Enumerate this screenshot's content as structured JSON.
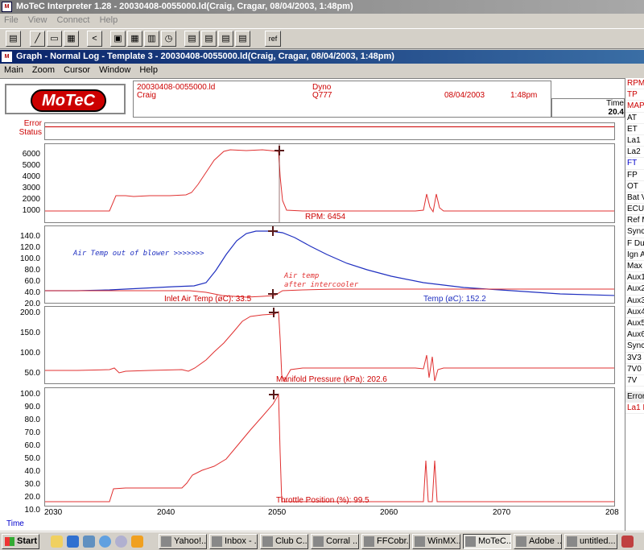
{
  "app_window": {
    "title": "MoTeC Interpreter 1.28 - 20030408-0055000.ld(Craig, Cragar, 08/04/2003,  1:48pm)",
    "menu": [
      "File",
      "View",
      "Connect",
      "Help"
    ]
  },
  "toolbar": {
    "buttons": [
      "open-icon",
      "graph-icon",
      "gauge-icon",
      "calc-icon",
      "back-icon",
      "report1-icon",
      "report2-icon",
      "report3-icon",
      "clock-icon",
      "export1-icon",
      "export2-icon",
      "export3-icon",
      "export4-icon"
    ],
    "ref_label": "ref"
  },
  "graph_window": {
    "title": "Graph - Normal Log - Template 3 - 20030408-0055000.ld(Craig, Cragar, 08/04/2003,  1:48pm)",
    "menu": [
      "Main",
      "Zoom",
      "Cursor",
      "Window",
      "Help"
    ]
  },
  "header": {
    "logo": "MoTeC",
    "file": "20030408-0055000.ld",
    "driver": "Craig",
    "session": "Dyno",
    "vehicle": "Q777",
    "date": "08/04/2003",
    "time": "1:48pm",
    "time_label": "Time",
    "time_value": "20.4"
  },
  "status_labels": {
    "error": "Error",
    "status": "Status"
  },
  "panels": [
    {
      "yticks": [
        "6000",
        "5000",
        "4000",
        "3000",
        "2000",
        "1000"
      ],
      "label": "RPM: 6454"
    },
    {
      "yticks": [
        "140.0",
        "120.0",
        "100.0",
        "80.0",
        "60.0",
        "40.0",
        "20.0"
      ],
      "label_inlet": "Inlet Air Temp (øC): 33.5",
      "label_temp": "Temp (øC): 152.2",
      "annot1": "Air Temp out of blower >>>>>>>",
      "annot2a": "Air temp",
      "annot2b": "after intercooler"
    },
    {
      "yticks": [
        "200.0",
        "150.0",
        "100.0",
        "50.0"
      ],
      "label": "Manifold Pressure (kPa): 202.6"
    },
    {
      "yticks": [
        "100.0",
        "90.0",
        "80.0",
        "70.0",
        "60.0",
        "50.0",
        "40.0",
        "30.0",
        "20.0",
        "10.0"
      ],
      "label": "Throttle Position (%): 99.5"
    }
  ],
  "x_axis": {
    "ticks": [
      "2030",
      "2040",
      "2050",
      "2060",
      "2070",
      "208"
    ],
    "label": "Time"
  },
  "channels": [
    "RPM",
    "TP",
    "MAP",
    "AT",
    "ET",
    "La1",
    "La2",
    "FT",
    "FP",
    "OT",
    "Bat V",
    "ECU",
    "Ref M",
    "Sync",
    "F Du",
    "Ign A",
    "Max",
    "Aux1",
    "Aux2",
    "Aux3",
    "Aux4",
    "Aux5",
    "Aux6",
    "Sync",
    "3V3",
    "7V0",
    "7V",
    "Error",
    "La1 L"
  ],
  "taskbar": {
    "start_label": "Start",
    "tasks": [
      "Yahoo!...",
      "Inbox - ...",
      "Club C...",
      "Corral ...",
      "FFCobr...",
      "WinMX...",
      "MoTeC...",
      "Adobe ...",
      "untitled..."
    ]
  },
  "colors": {
    "trace_red": "#e03030",
    "trace_blue": "#2030c0",
    "cursor": "#5a1a1a",
    "title_active": "#0a246a"
  }
}
